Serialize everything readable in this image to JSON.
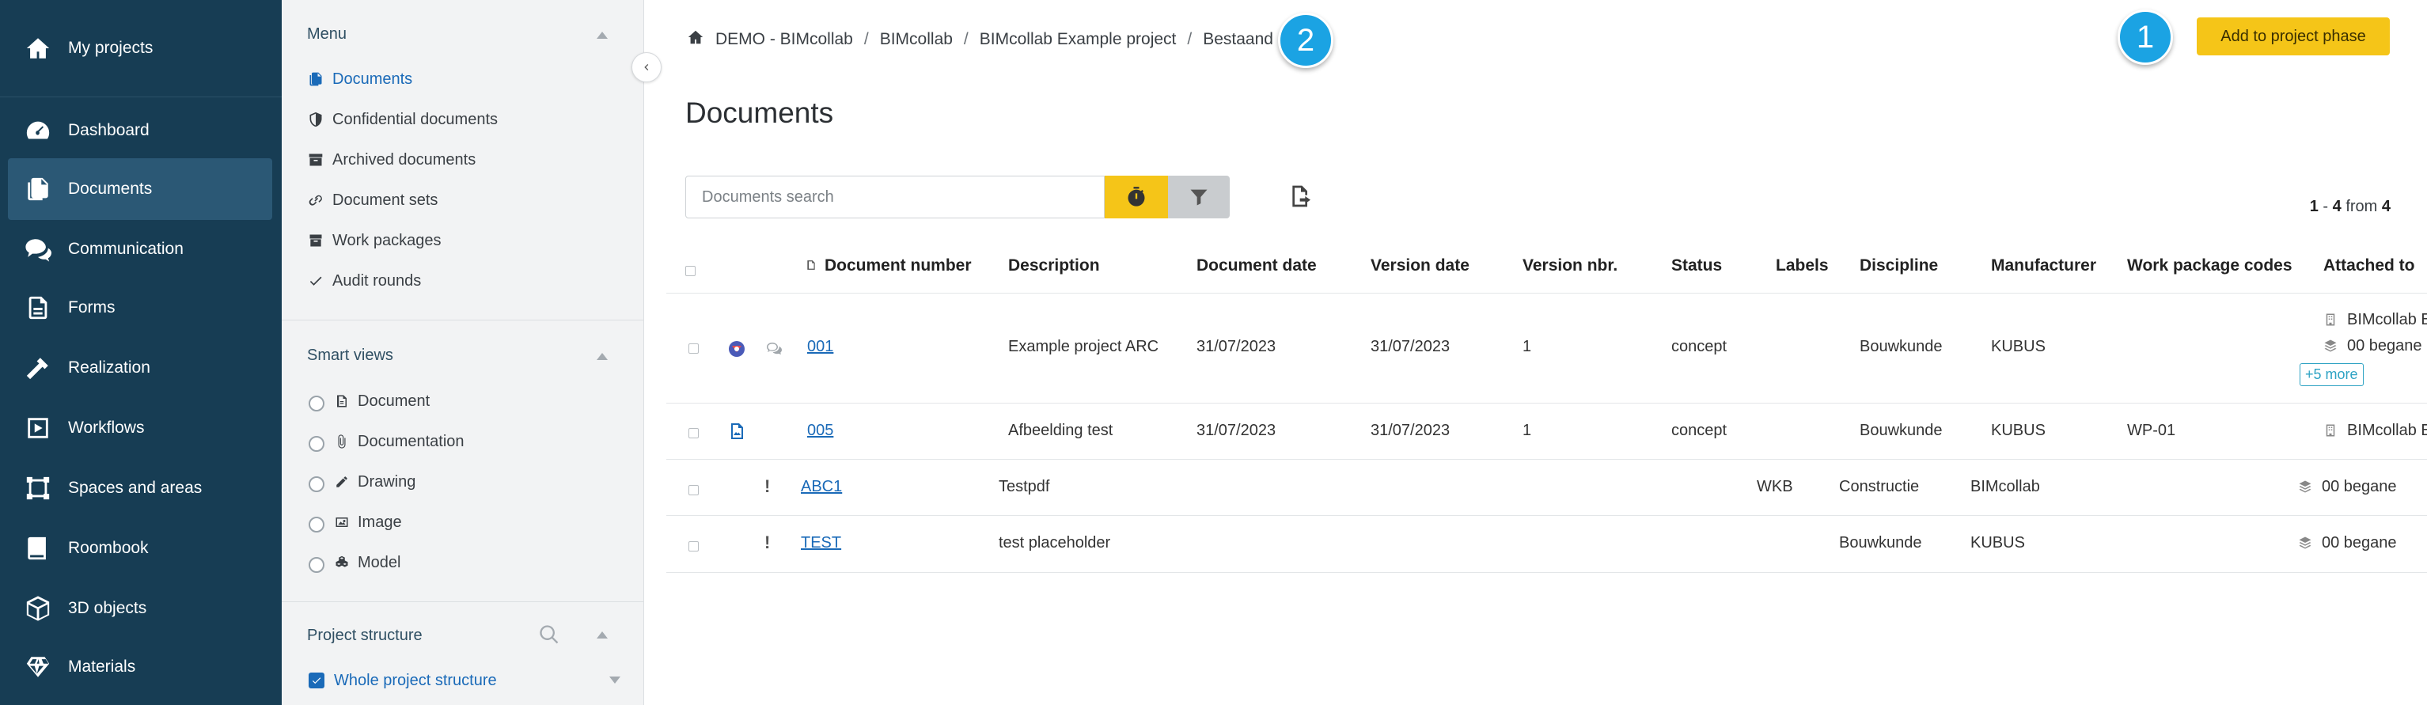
{
  "nav": {
    "items": [
      {
        "label": "My projects",
        "icon": "home-icon"
      },
      {
        "label": "Dashboard",
        "icon": "dashboard-icon"
      },
      {
        "label": "Documents",
        "icon": "documents-icon"
      },
      {
        "label": "Communication",
        "icon": "chat-icon"
      },
      {
        "label": "Forms",
        "icon": "form-icon"
      },
      {
        "label": "Realization",
        "icon": "hammer-icon"
      },
      {
        "label": "Workflows",
        "icon": "play-icon"
      },
      {
        "label": "Spaces and areas",
        "icon": "spaces-icon"
      },
      {
        "label": "Roombook",
        "icon": "book-icon"
      },
      {
        "label": "3D objects",
        "icon": "cube-icon"
      },
      {
        "label": "Materials",
        "icon": "diamond-icon"
      }
    ],
    "active": "Documents"
  },
  "menu": {
    "title": "Menu",
    "items": [
      {
        "label": "Documents",
        "icon": "documents-icon"
      },
      {
        "label": "Confidential documents",
        "icon": "shield-icon"
      },
      {
        "label": "Archived documents",
        "icon": "archive-icon"
      },
      {
        "label": "Document sets",
        "icon": "link-icon"
      },
      {
        "label": "Work packages",
        "icon": "package-icon"
      },
      {
        "label": "Audit rounds",
        "icon": "check-icon"
      }
    ]
  },
  "smart_views": {
    "title": "Smart views",
    "items": [
      {
        "label": "Document",
        "icon": "file-icon"
      },
      {
        "label": "Documentation",
        "icon": "paperclip-icon"
      },
      {
        "label": "Drawing",
        "icon": "pencil-icon"
      },
      {
        "label": "Image",
        "icon": "image-icon"
      },
      {
        "label": "Model",
        "icon": "cubes-icon"
      }
    ]
  },
  "project_structure": {
    "title": "Project structure",
    "selected": "Whole project structure"
  },
  "breadcrumb": {
    "items": [
      "DEMO - BIMcollab",
      "BIMcollab",
      "BIMcollab Example project",
      "Bestaand"
    ]
  },
  "badges": {
    "one": "1",
    "two": "2"
  },
  "header": {
    "add_phase_label": "Add to project phase"
  },
  "page": {
    "title": "Documents"
  },
  "search": {
    "placeholder": "Documents search"
  },
  "pagination": {
    "from_num": "1",
    "to_num": "4",
    "word": "from",
    "total": "4"
  },
  "table": {
    "headers": {
      "number": "Document number",
      "description": "Description",
      "doc_date": "Document date",
      "version_date": "Version date",
      "version_nbr": "Version nbr.",
      "status": "Status",
      "labels": "Labels",
      "discipline": "Discipline",
      "manufacturer": "Manufacturer",
      "wp_codes": "Work package codes",
      "attached": "Attached to"
    },
    "rows": [
      {
        "number": "001",
        "description": "Example project ARC",
        "doc_date": "31/07/2023",
        "version_date": "31/07/2023",
        "version_nbr": "1",
        "status": "concept",
        "labels": "",
        "discipline": "Bouwkunde",
        "manufacturer": "KUBUS",
        "wp_codes": "",
        "attached": [
          "BIMcollab E",
          "00 begane"
        ],
        "more": "+5 more"
      },
      {
        "number": "005",
        "description": "Afbeelding test",
        "doc_date": "31/07/2023",
        "version_date": "31/07/2023",
        "version_nbr": "1",
        "status": "concept",
        "labels": "",
        "discipline": "Bouwkunde",
        "manufacturer": "KUBUS",
        "wp_codes": "WP-01",
        "attached": [
          "BIMcollab E"
        ]
      },
      {
        "number": "ABC1",
        "description": "Testpdf",
        "doc_date": "",
        "version_date": "",
        "version_nbr": "",
        "status": "",
        "labels": "WKB",
        "discipline": "Constructie",
        "manufacturer": "BIMcollab",
        "wp_codes": "",
        "attached": [
          "00 begane"
        ]
      },
      {
        "number": "TEST",
        "description": "test placeholder",
        "doc_date": "",
        "version_date": "",
        "version_nbr": "",
        "status": "",
        "labels": "",
        "discipline": "Bouwkunde",
        "manufacturer": "KUBUS",
        "wp_codes": "",
        "attached": [
          "00 begane"
        ]
      }
    ]
  },
  "colors": {
    "nav_bg": "#173d54",
    "nav_active": "#2b5875",
    "accent_yellow": "#f5c518",
    "badge_blue": "#1ba3e3",
    "link_blue": "#1a6ab8"
  }
}
